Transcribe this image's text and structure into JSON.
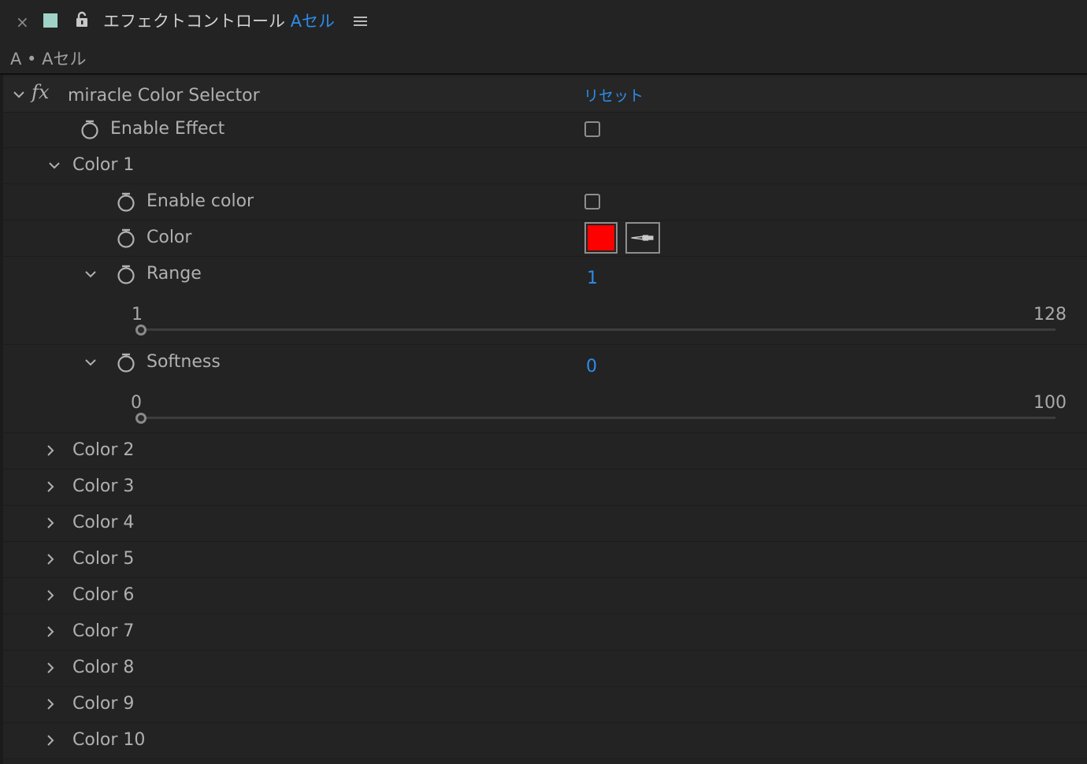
{
  "tab": {
    "close_glyph": "×",
    "title": "エフェクトコントロール",
    "layer_name": "Aセル",
    "swatch_color": "#9fd3c7"
  },
  "subheader": "A • Aセル",
  "effect": {
    "fx_glyph": "fx",
    "name": "miracle Color Selector",
    "reset_label": "リセット"
  },
  "enable_effect": {
    "label": "Enable Effect",
    "checked": false
  },
  "color1": {
    "label": "Color 1",
    "enable_color": {
      "label": "Enable color",
      "checked": false
    },
    "color": {
      "label": "Color",
      "value": "#ff0000"
    },
    "range": {
      "label": "Range",
      "value": "1",
      "min": "1",
      "max": "128",
      "position": 0
    },
    "softness": {
      "label": "Softness",
      "value": "0",
      "min": "0",
      "max": "100",
      "position": 0
    }
  },
  "collapsed_groups": [
    "Color 2",
    "Color 3",
    "Color 4",
    "Color 5",
    "Color 6",
    "Color 7",
    "Color 8",
    "Color 9",
    "Color 10"
  ],
  "colors": {
    "accent": "#2d8ceb",
    "background": "#232323",
    "text": "#b0b0b0"
  }
}
